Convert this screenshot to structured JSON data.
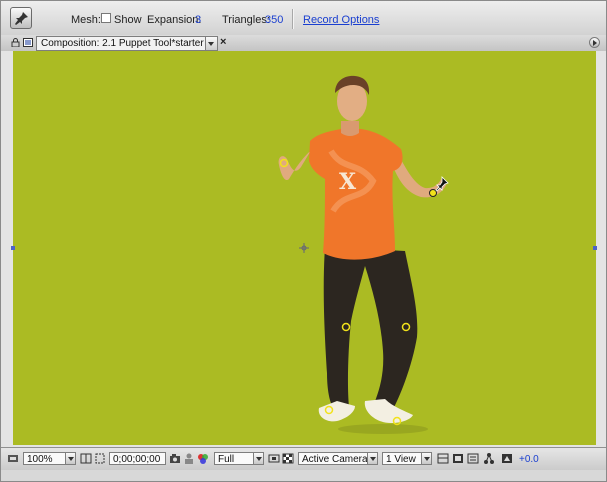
{
  "tool_options": {
    "mesh_label": "Mesh:",
    "show_label": "Show",
    "show_checked": false,
    "expansion_label": "Expansion:",
    "expansion_value": "3",
    "triangles_label": "Triangles:",
    "triangles_value": "350",
    "record_options_label": "Record Options",
    "tool_icon": "puppet-pin-icon"
  },
  "composition_panel": {
    "tab_title": "Composition: 2.1 Puppet Tool*starter",
    "close_glyph": "×"
  },
  "viewer": {
    "background_color": "#abbb23",
    "pin_color": "#f2e21a",
    "active_pin_color": "#f2e21a"
  },
  "bottom_bar": {
    "magnification": "100%",
    "timecode": "0;00;00;00",
    "resolution": "Full",
    "camera": "Active Camera",
    "view_layout": "1 View",
    "exposure": "+0.0"
  }
}
